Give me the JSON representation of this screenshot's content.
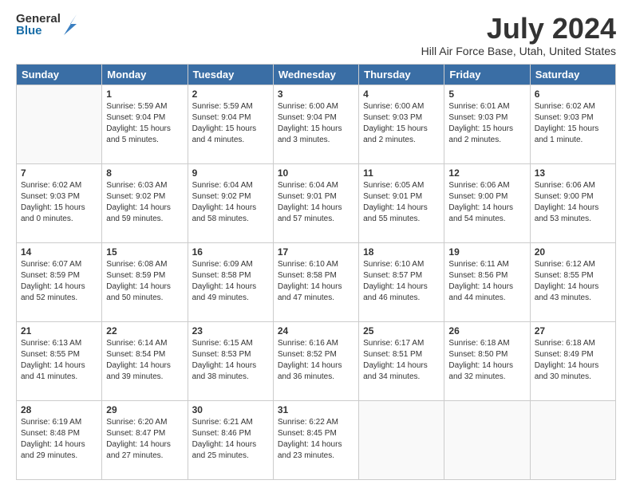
{
  "logo": {
    "general": "General",
    "blue": "Blue"
  },
  "title": "July 2024",
  "subtitle": "Hill Air Force Base, Utah, United States",
  "headers": [
    "Sunday",
    "Monday",
    "Tuesday",
    "Wednesday",
    "Thursday",
    "Friday",
    "Saturday"
  ],
  "weeks": [
    [
      {
        "day": "",
        "info": ""
      },
      {
        "day": "1",
        "info": "Sunrise: 5:59 AM\nSunset: 9:04 PM\nDaylight: 15 hours\nand 5 minutes."
      },
      {
        "day": "2",
        "info": "Sunrise: 5:59 AM\nSunset: 9:04 PM\nDaylight: 15 hours\nand 4 minutes."
      },
      {
        "day": "3",
        "info": "Sunrise: 6:00 AM\nSunset: 9:04 PM\nDaylight: 15 hours\nand 3 minutes."
      },
      {
        "day": "4",
        "info": "Sunrise: 6:00 AM\nSunset: 9:03 PM\nDaylight: 15 hours\nand 2 minutes."
      },
      {
        "day": "5",
        "info": "Sunrise: 6:01 AM\nSunset: 9:03 PM\nDaylight: 15 hours\nand 2 minutes."
      },
      {
        "day": "6",
        "info": "Sunrise: 6:02 AM\nSunset: 9:03 PM\nDaylight: 15 hours\nand 1 minute."
      }
    ],
    [
      {
        "day": "7",
        "info": "Sunrise: 6:02 AM\nSunset: 9:03 PM\nDaylight: 15 hours\nand 0 minutes."
      },
      {
        "day": "8",
        "info": "Sunrise: 6:03 AM\nSunset: 9:02 PM\nDaylight: 14 hours\nand 59 minutes."
      },
      {
        "day": "9",
        "info": "Sunrise: 6:04 AM\nSunset: 9:02 PM\nDaylight: 14 hours\nand 58 minutes."
      },
      {
        "day": "10",
        "info": "Sunrise: 6:04 AM\nSunset: 9:01 PM\nDaylight: 14 hours\nand 57 minutes."
      },
      {
        "day": "11",
        "info": "Sunrise: 6:05 AM\nSunset: 9:01 PM\nDaylight: 14 hours\nand 55 minutes."
      },
      {
        "day": "12",
        "info": "Sunrise: 6:06 AM\nSunset: 9:00 PM\nDaylight: 14 hours\nand 54 minutes."
      },
      {
        "day": "13",
        "info": "Sunrise: 6:06 AM\nSunset: 9:00 PM\nDaylight: 14 hours\nand 53 minutes."
      }
    ],
    [
      {
        "day": "14",
        "info": "Sunrise: 6:07 AM\nSunset: 8:59 PM\nDaylight: 14 hours\nand 52 minutes."
      },
      {
        "day": "15",
        "info": "Sunrise: 6:08 AM\nSunset: 8:59 PM\nDaylight: 14 hours\nand 50 minutes."
      },
      {
        "day": "16",
        "info": "Sunrise: 6:09 AM\nSunset: 8:58 PM\nDaylight: 14 hours\nand 49 minutes."
      },
      {
        "day": "17",
        "info": "Sunrise: 6:10 AM\nSunset: 8:58 PM\nDaylight: 14 hours\nand 47 minutes."
      },
      {
        "day": "18",
        "info": "Sunrise: 6:10 AM\nSunset: 8:57 PM\nDaylight: 14 hours\nand 46 minutes."
      },
      {
        "day": "19",
        "info": "Sunrise: 6:11 AM\nSunset: 8:56 PM\nDaylight: 14 hours\nand 44 minutes."
      },
      {
        "day": "20",
        "info": "Sunrise: 6:12 AM\nSunset: 8:55 PM\nDaylight: 14 hours\nand 43 minutes."
      }
    ],
    [
      {
        "day": "21",
        "info": "Sunrise: 6:13 AM\nSunset: 8:55 PM\nDaylight: 14 hours\nand 41 minutes."
      },
      {
        "day": "22",
        "info": "Sunrise: 6:14 AM\nSunset: 8:54 PM\nDaylight: 14 hours\nand 39 minutes."
      },
      {
        "day": "23",
        "info": "Sunrise: 6:15 AM\nSunset: 8:53 PM\nDaylight: 14 hours\nand 38 minutes."
      },
      {
        "day": "24",
        "info": "Sunrise: 6:16 AM\nSunset: 8:52 PM\nDaylight: 14 hours\nand 36 minutes."
      },
      {
        "day": "25",
        "info": "Sunrise: 6:17 AM\nSunset: 8:51 PM\nDaylight: 14 hours\nand 34 minutes."
      },
      {
        "day": "26",
        "info": "Sunrise: 6:18 AM\nSunset: 8:50 PM\nDaylight: 14 hours\nand 32 minutes."
      },
      {
        "day": "27",
        "info": "Sunrise: 6:18 AM\nSunset: 8:49 PM\nDaylight: 14 hours\nand 30 minutes."
      }
    ],
    [
      {
        "day": "28",
        "info": "Sunrise: 6:19 AM\nSunset: 8:48 PM\nDaylight: 14 hours\nand 29 minutes."
      },
      {
        "day": "29",
        "info": "Sunrise: 6:20 AM\nSunset: 8:47 PM\nDaylight: 14 hours\nand 27 minutes."
      },
      {
        "day": "30",
        "info": "Sunrise: 6:21 AM\nSunset: 8:46 PM\nDaylight: 14 hours\nand 25 minutes."
      },
      {
        "day": "31",
        "info": "Sunrise: 6:22 AM\nSunset: 8:45 PM\nDaylight: 14 hours\nand 23 minutes."
      },
      {
        "day": "",
        "info": ""
      },
      {
        "day": "",
        "info": ""
      },
      {
        "day": "",
        "info": ""
      }
    ]
  ]
}
